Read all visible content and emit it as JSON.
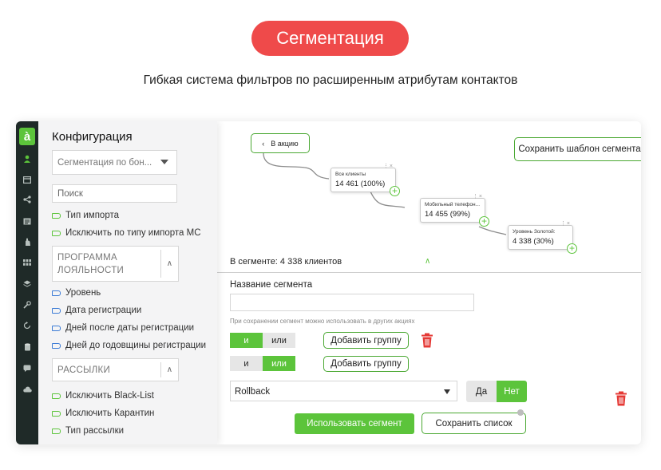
{
  "hero": {
    "badge": "Сегментация",
    "subtitle": "Гибкая система фильтров по расширенным атрибутам контактов"
  },
  "colors": {
    "accent": "#5cc43b",
    "badge": "#ef4a4a",
    "rail": "#1f2a28",
    "danger": "#e53935",
    "blue": "#3b7bd6"
  },
  "rail": {
    "logo": "à",
    "icons": [
      "user-icon",
      "window-icon",
      "share-icon",
      "list-icon",
      "hand-icon",
      "grid-icon",
      "layers-icon",
      "wrench-icon",
      "sync-icon",
      "cylinder-icon",
      "chat-icon",
      "cloud-icon"
    ]
  },
  "config": {
    "title": "Конфигурация",
    "segment_select": "Сегментация по бон...",
    "search_placeholder": "Поиск",
    "import_items": [
      "Тип импорта",
      "Исключить по типу импорта МС"
    ],
    "loyalty": {
      "label_line1": "ПРОГРАММА",
      "label_line2": "ЛОЯЛЬНОСТИ",
      "items": [
        "Уровень",
        "Дата регистрации",
        "Дней после даты регистрации",
        "Дней до годовщины регистрации"
      ]
    },
    "mailings": {
      "label": "РАССЫЛКИ",
      "items": [
        "Исключить Black-List",
        "Исключить Карантин",
        "Тип рассылки"
      ]
    }
  },
  "main": {
    "back_button": "В акцию",
    "save_template_button": "Сохранить шаблон сегмента",
    "flow_nodes": [
      {
        "title": "Все клиенты",
        "value": "14 461 (100%)"
      },
      {
        "title": "Мобильный телефон...",
        "value": "14 455 (99%)"
      },
      {
        "title": "Уровень Золотой:",
        "value": "4 338 (30%)"
      }
    ],
    "in_segment": "В сегменте: 4 338 клиентов",
    "name_label": "Название сегмента",
    "name_value": "",
    "hint": "При сохранении сегмент можно использовать в других акциях",
    "group_rows": [
      {
        "and_label": "и",
        "or_label": "или",
        "selected": "and",
        "add_group": "Добавить группу"
      },
      {
        "and_label": "и",
        "or_label": "или",
        "selected": "or",
        "add_group": "Добавить группу"
      }
    ],
    "rollback_select": "Rollback",
    "yes_label": "Да",
    "no_label": "Нет",
    "yes_no_selected": "no",
    "use_segment_button": "Использовать сегмент",
    "save_list_button": "Сохранить список"
  }
}
